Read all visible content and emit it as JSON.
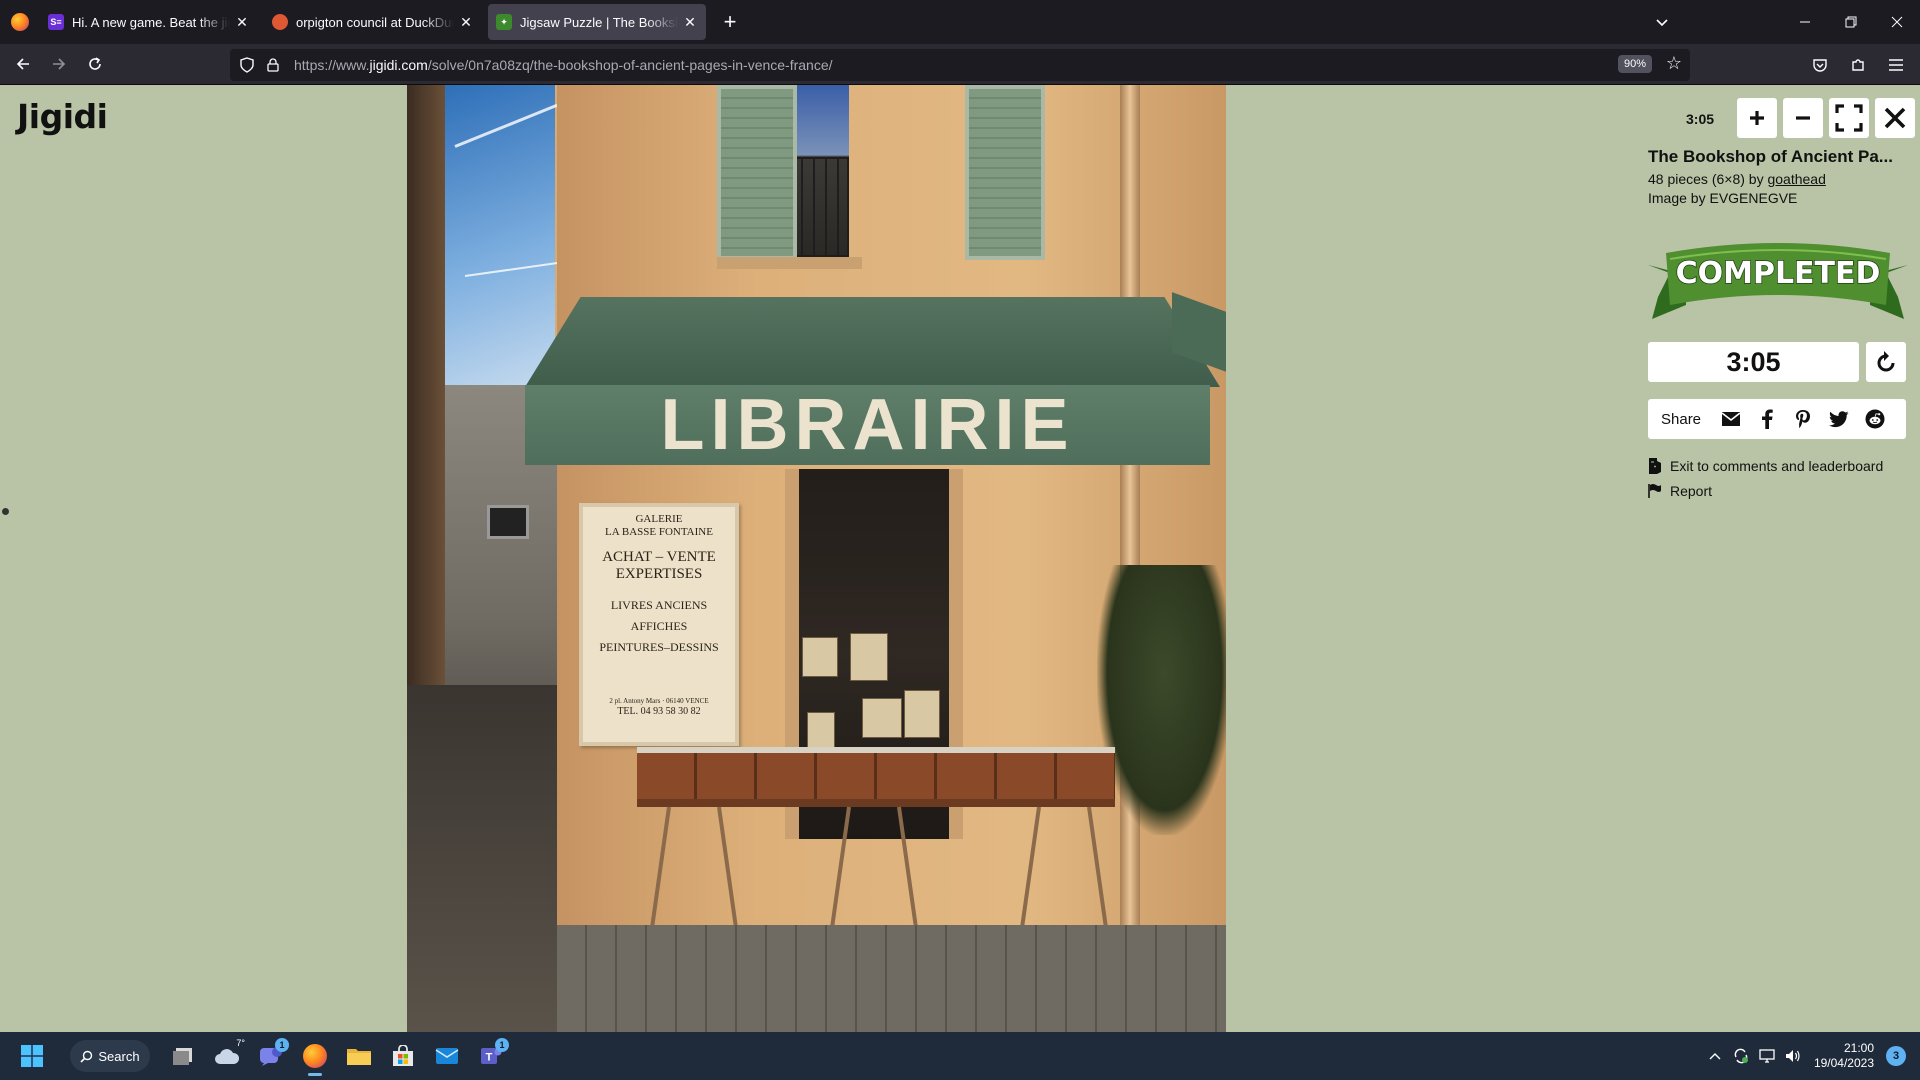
{
  "browser": {
    "tabs": [
      {
        "title": "Hi. A new game. Beat the jigsaw",
        "favicon": "s-equals-icon",
        "active": false
      },
      {
        "title": "orpigton council at DuckDuckGo",
        "favicon": "duckduckgo-icon",
        "active": false
      },
      {
        "title": "Jigsaw Puzzle | The Bookshop of Ancient Pages",
        "favicon": "jigidi-icon",
        "active": true
      }
    ],
    "new_tab_label": "+",
    "url_prefix": "https://www.",
    "url_domain": "jigidi.com",
    "url_path": "/solve/0n7a08zq/the-bookshop-of-ancient-pages-in-vence-france/",
    "zoom": "90%"
  },
  "page": {
    "logo": "Jigidi",
    "puzzle_image": {
      "awning_text": "LIBRAIRIE",
      "sign_lines": [
        "GALERIE",
        "LA BASSE FONTAINE",
        "ACHAT – VENTE",
        "EXPERTISES",
        "LIVRES ANCIENS",
        "AFFICHES",
        "PEINTURES–DESSINS",
        "2 pl. Antony Mars · 06140 VENCE",
        "TEL. 04 93 58 30 82"
      ]
    },
    "panel": {
      "timer_small": "3:05",
      "title": "The Bookshop of Ancient Pa...",
      "pieces_text": "48 pieces (6×8) by ",
      "author": "goathead",
      "image_credit": "Image by EVGENEGVE",
      "banner_text": "COMPLETED",
      "timer_big": "3:05",
      "share_label": "Share",
      "exit_link": "Exit to comments and leaderboard",
      "report_link": "Report",
      "colors": {
        "banner_green": "#4f8f2f",
        "banner_dark": "#2f6b1f",
        "panel_bg": "#b8c4a5"
      }
    }
  },
  "taskbar": {
    "search_label": "Search",
    "weather_temp": "7°",
    "teams_badge": "1",
    "teams2_badge": "1",
    "time": "21:00",
    "date": "19/04/2023",
    "notifications": "3"
  }
}
